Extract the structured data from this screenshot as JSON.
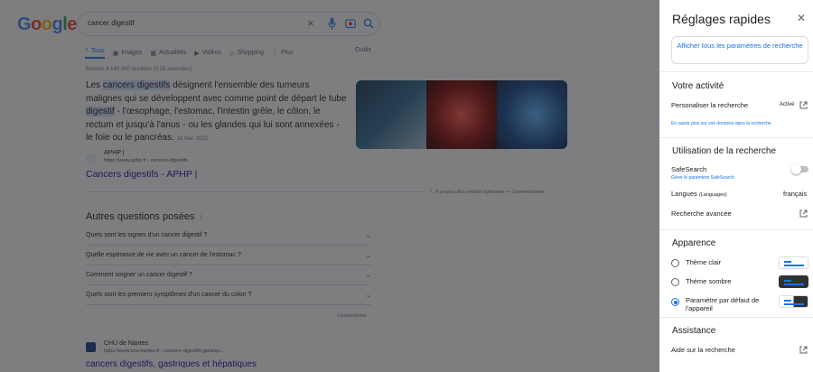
{
  "search": {
    "query": "cancer digestif",
    "logo_letters": [
      "G",
      "o",
      "o",
      "g",
      "l",
      "e"
    ]
  },
  "tabs": [
    {
      "label": "Tous",
      "icon": "search-icon",
      "active": true
    },
    {
      "label": "Images",
      "icon": "image-icon",
      "active": false
    },
    {
      "label": "Actualités",
      "icon": "news-icon",
      "active": false
    },
    {
      "label": "Vidéos",
      "icon": "video-icon",
      "active": false
    },
    {
      "label": "Shopping",
      "icon": "tag-icon",
      "active": false
    },
    {
      "label": "Plus",
      "icon": "more-icon",
      "active": false
    }
  ],
  "tools_label": "Outils",
  "result_count": "Environ 4 140 000 résultats (0,25 secondes)",
  "snippet": {
    "part1": "Les ",
    "hl1": "cancers digestifs",
    "part2": " désignent l'ensemble des tumeurs malignes qui se développent avec comme point de départ le tube ",
    "hl2": "digestif",
    "part3": " - l'œsophage, l'estomac, l'intestin grêle, le côlon, le rectum et jusqu'à l'anus - ou les glandes qui lui sont annexées - le foie ou le pancréas.",
    "date": "16 févr. 2022"
  },
  "result1": {
    "site_name": "APHP |",
    "url": "https://www.aphp.fr › cancers-digestifs",
    "title": "Cancers digestifs - APHP |"
  },
  "about_text": "À propos des extraits optimisés",
  "feedback_label": "Commentaires",
  "paa": {
    "title": "Autres questions posées",
    "questions": [
      "Quels sont les signes d'un cancer digestif ?",
      "Quelle espérance de vie avec un cancer de l'estomac ?",
      "Comment soigner un cancer digestif ?",
      "Quels sont les premiers symptômes d'un cancer du colon ?"
    ],
    "feedback": "Commentaires"
  },
  "result2": {
    "site_name": "CHU de Nantes",
    "url": "https://www.chu-nantes.fr › cancers-digestifs-gastriqu...",
    "title": "cancers digestifs, gastriques et hépatiques"
  },
  "panel": {
    "title": "Réglages rapides",
    "all_settings": "Afficher tous les paramètres de recherche",
    "activity": {
      "heading": "Votre activité",
      "personalize_label": "Personaliser la recherche",
      "personalize_value": "Activé",
      "learn_more": "En savoir plus sur vos données dans la recherche"
    },
    "usage": {
      "heading": "Utilisation de la recherche",
      "safesearch_label": "SafeSearch",
      "safesearch_sub": "Gérer le paramètre SafeSearch",
      "languages_label": "Langues",
      "languages_sub": "(Languages)",
      "languages_value": "français",
      "advanced_label": "Recherche avancée"
    },
    "appearance": {
      "heading": "Apparence",
      "options": [
        {
          "label": "Thème clair",
          "selected": false,
          "thumb": "light"
        },
        {
          "label": "Thème sombre",
          "selected": false,
          "thumb": "dark"
        },
        {
          "label": "Paramètre par défaut de l'appareil",
          "selected": true,
          "thumb": "dev"
        }
      ]
    },
    "assistance": {
      "heading": "Assistance",
      "help_label": "Aide sur la recherche"
    }
  },
  "colors": {
    "accent": "#1a73e8",
    "link": "#1a0dab",
    "overlay": "#202124"
  }
}
